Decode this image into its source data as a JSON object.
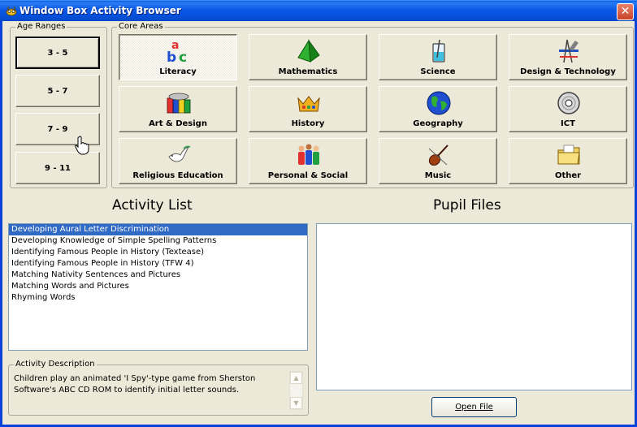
{
  "window": {
    "title": "Window Box Activity Browser",
    "close_glyph": "✕"
  },
  "age_ranges": {
    "label": "Age Ranges",
    "items": [
      {
        "label": "3 - 5",
        "selected": true
      },
      {
        "label": "5 - 7",
        "selected": false
      },
      {
        "label": "7 - 9",
        "selected": false
      },
      {
        "label": "9 - 11",
        "selected": false
      }
    ]
  },
  "core_areas": {
    "label": "Core Areas",
    "items": [
      {
        "label": "Literacy",
        "icon": "abc-blocks-icon",
        "selected": true
      },
      {
        "label": "Mathematics",
        "icon": "pyramid-icon",
        "selected": false
      },
      {
        "label": "Science",
        "icon": "beaker-icon",
        "selected": false
      },
      {
        "label": "Design & Technology",
        "icon": "drafting-tools-icon",
        "selected": false
      },
      {
        "label": "Art & Design",
        "icon": "paint-pots-icon",
        "selected": false
      },
      {
        "label": "History",
        "icon": "crown-icon",
        "selected": false
      },
      {
        "label": "Geography",
        "icon": "globe-icon",
        "selected": false
      },
      {
        "label": "ICT",
        "icon": "cd-rom-icon",
        "selected": false
      },
      {
        "label": "Religious Education",
        "icon": "dove-icon",
        "selected": false
      },
      {
        "label": "Personal & Social",
        "icon": "people-icon",
        "selected": false
      },
      {
        "label": "Music",
        "icon": "violin-icon",
        "selected": false
      },
      {
        "label": "Other",
        "icon": "folder-icon",
        "selected": false
      }
    ]
  },
  "activity_list": {
    "heading": "Activity List",
    "items": [
      {
        "label": "Developing Aural Letter Discrimination",
        "selected": true
      },
      {
        "label": "Developing Knowledge of Simple Spelling Patterns",
        "selected": false
      },
      {
        "label": "Identifying Famous People in History (Textease)",
        "selected": false
      },
      {
        "label": "Identifying Famous People in History (TFW 4)",
        "selected": false
      },
      {
        "label": "Matching Nativity Sentences and Pictures",
        "selected": false
      },
      {
        "label": "Matching Words and Pictures",
        "selected": false
      },
      {
        "label": "Rhyming Words",
        "selected": false
      }
    ]
  },
  "activity_description": {
    "label": "Activity Description",
    "text": "Children play an animated 'I Spy'-type game from Sherston Software's ABC CD ROM to identify initial letter sounds."
  },
  "pupil_files": {
    "heading": "Pupil Files",
    "open_button": "Open File"
  },
  "colors": {
    "title_bar": "#0a58e6",
    "selection": "#316ac5",
    "face": "#ece9d8"
  }
}
